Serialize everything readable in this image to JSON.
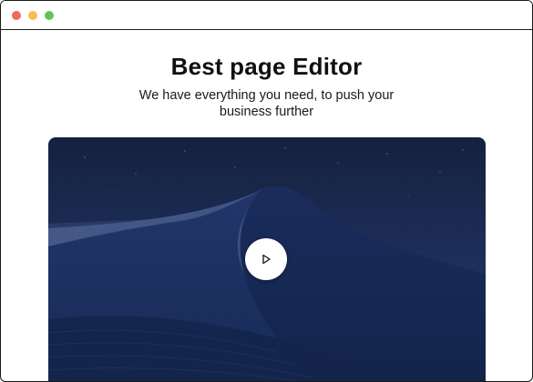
{
  "window": {
    "controls": {
      "close_color": "#ed6a5e",
      "minimize_color": "#f5bf4f",
      "maximize_color": "#61c554"
    }
  },
  "hero": {
    "title": "Best page Editor",
    "subtitle": "We have everything you need, to push your business further"
  },
  "video": {
    "play_icon": "play-icon"
  }
}
